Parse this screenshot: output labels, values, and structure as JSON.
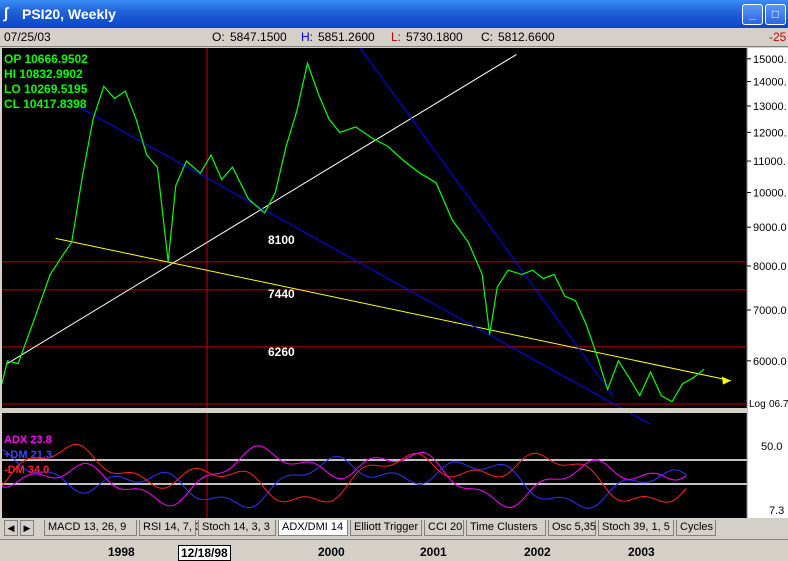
{
  "window": {
    "title": "PSI20, Weekly"
  },
  "infobar": {
    "date": "07/25/03",
    "open_label": "O:",
    "open": "5847.1500",
    "high_label": "H:",
    "high": "5851.2600",
    "low_label": "L:",
    "low": "5730.1800",
    "close_label": "C:",
    "close": "5812.6600",
    "change": "-25"
  },
  "ohlc_panel": {
    "op": "OP 10666.9502",
    "hi": "HI  10832.9902",
    "lo": "LO  10269.5195",
    "cl": "CL  10417.8398"
  },
  "price_axis": {
    "ticks": [
      {
        "value": 15000,
        "label": "15000."
      },
      {
        "value": 14000,
        "label": "14000."
      },
      {
        "value": 13000,
        "label": "13000."
      },
      {
        "value": 12000,
        "label": "12000."
      },
      {
        "value": 11000,
        "label": "11000."
      },
      {
        "value": 10000,
        "label": "10000."
      },
      {
        "value": 9000,
        "label": "9000.0"
      },
      {
        "value": 8000,
        "label": "8000.0"
      },
      {
        "value": 7000,
        "label": "7000.0"
      },
      {
        "value": 6000,
        "label": "6000.0"
      }
    ],
    "log_marker": "Log",
    "edge_value": "06.7"
  },
  "levels": [
    {
      "value": 8100,
      "label": "8100"
    },
    {
      "value": 7440,
      "label": "7440"
    },
    {
      "value": 6260,
      "label": "6260"
    }
  ],
  "indicator": {
    "adx": "ADX 23.8",
    "plus_dm": "+DM 21.3",
    "minus_dm": "-DM 34.0",
    "axis_upper": "50.0",
    "axis_lower": "7.3",
    "colors": {
      "adx": "#ff00ff",
      "plus_dm": "#3030ff",
      "minus_dm": "#ff2020"
    }
  },
  "tabs": [
    "MACD 13, 26, 9",
    "RSI 14, 7, 3",
    "Stoch 14, 3, 3",
    "ADX/DMI 14",
    "Elliott Trigger",
    "CCI 20",
    "Time Clusters",
    "Osc 5,35",
    "Stoch 39, 1, 5",
    "Cycles"
  ],
  "active_tab": "ADX/DMI 14",
  "time_axis": {
    "labels": [
      "1998",
      "2000",
      "2001",
      "2002",
      "2003"
    ],
    "cursor_date": "12/18/98"
  },
  "chart_data": {
    "type": "line",
    "title": "PSI20, Weekly",
    "y_scale": "log",
    "ylim": [
      5200,
      15500
    ],
    "series": [
      {
        "name": "PSI20",
        "color": "#00ff00",
        "points": [
          [
            1997.0,
            5600
          ],
          [
            1997.05,
            6000
          ],
          [
            1997.15,
            5950
          ],
          [
            1997.3,
            6800
          ],
          [
            1997.45,
            7800
          ],
          [
            1997.55,
            8200
          ],
          [
            1997.65,
            8600
          ],
          [
            1997.75,
            10500
          ],
          [
            1997.85,
            12500
          ],
          [
            1997.95,
            13800
          ],
          [
            1998.05,
            13300
          ],
          [
            1998.15,
            13600
          ],
          [
            1998.25,
            12500
          ],
          [
            1998.35,
            11200
          ],
          [
            1998.45,
            10800
          ],
          [
            1998.55,
            8100
          ],
          [
            1998.62,
            10200
          ],
          [
            1998.72,
            11000
          ],
          [
            1998.85,
            10600
          ],
          [
            1998.95,
            11200
          ],
          [
            1999.05,
            10400
          ],
          [
            1999.15,
            10800
          ],
          [
            1999.3,
            9800
          ],
          [
            1999.45,
            9400
          ],
          [
            1999.55,
            10000
          ],
          [
            1999.65,
            11500
          ],
          [
            1999.75,
            12800
          ],
          [
            1999.85,
            14800
          ],
          [
            1999.95,
            13500
          ],
          [
            2000.05,
            12500
          ],
          [
            2000.15,
            12000
          ],
          [
            2000.3,
            12200
          ],
          [
            2000.45,
            11800
          ],
          [
            2000.6,
            11500
          ],
          [
            2000.75,
            11000
          ],
          [
            2000.9,
            10600
          ],
          [
            2001.05,
            10300
          ],
          [
            2001.2,
            9200
          ],
          [
            2001.35,
            8600
          ],
          [
            2001.48,
            7800
          ],
          [
            2001.55,
            6500
          ],
          [
            2001.62,
            7500
          ],
          [
            2001.72,
            7900
          ],
          [
            2001.85,
            7800
          ],
          [
            2001.95,
            7900
          ],
          [
            2002.05,
            7700
          ],
          [
            2002.15,
            7800
          ],
          [
            2002.25,
            7300
          ],
          [
            2002.35,
            7200
          ],
          [
            2002.45,
            6700
          ],
          [
            2002.55,
            6100
          ],
          [
            2002.65,
            5500
          ],
          [
            2002.75,
            6000
          ],
          [
            2002.85,
            5700
          ],
          [
            2002.95,
            5400
          ],
          [
            2003.05,
            5800
          ],
          [
            2003.15,
            5400
          ],
          [
            2003.25,
            5300
          ],
          [
            2003.35,
            5600
          ],
          [
            2003.45,
            5700
          ],
          [
            2003.55,
            5850
          ]
        ]
      }
    ],
    "trendlines": [
      {
        "color": "#ffffff",
        "from": [
          1997.05,
          5950
        ],
        "to": [
          2001.8,
          15200
        ]
      },
      {
        "color": "#ffff00",
        "from": [
          1997.5,
          8700
        ],
        "to": [
          2003.8,
          5650
        ]
      },
      {
        "color": "#0000ff",
        "from": [
          1997.7,
          13000
        ],
        "to": [
          2003.05,
          4950
        ]
      },
      {
        "color": "#0000ff",
        "from": [
          2000.2,
          16500
        ],
        "to": [
          2002.7,
          5400
        ]
      }
    ]
  }
}
